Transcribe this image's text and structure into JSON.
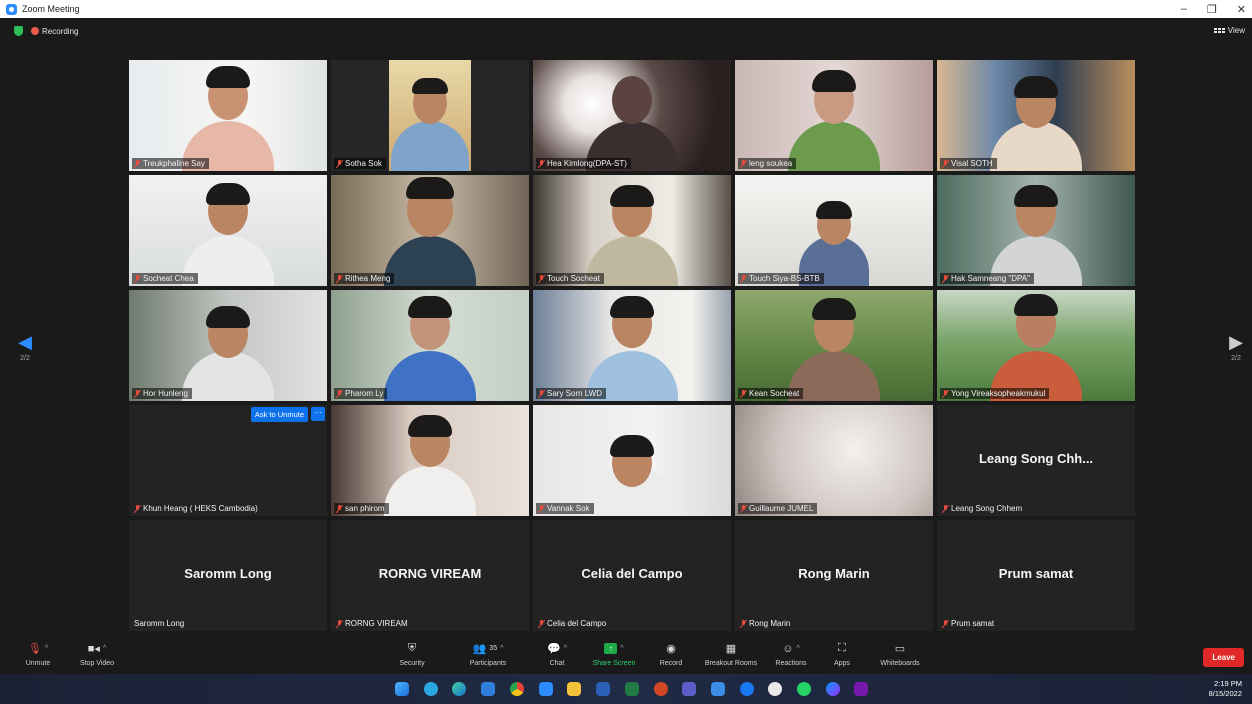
{
  "window": {
    "title": "Zoom Meeting",
    "min": "–",
    "restore": "❐",
    "close": "✕"
  },
  "header": {
    "recording_label": "Recording",
    "view_label": "View"
  },
  "pagination": {
    "left_page": "2/2",
    "right_page": "2/2"
  },
  "participants": [
    {
      "name": "Treukphaline Say",
      "muted": true
    },
    {
      "name": "Sotha Sok",
      "muted": true
    },
    {
      "name": "Hea Kimlong(DPA-ST)",
      "muted": true
    },
    {
      "name": "leng soukea",
      "muted": true
    },
    {
      "name": "Visal SOTH",
      "muted": true
    },
    {
      "name": "Socheat Chea",
      "muted": true
    },
    {
      "name": "Rithea Meng",
      "muted": true
    },
    {
      "name": "Touch Socheat",
      "muted": true
    },
    {
      "name": "Touch Siya-BS-BTB",
      "muted": true
    },
    {
      "name": "Hak Samneang \"DPA\"",
      "muted": true
    },
    {
      "name": "Hor Hunleng",
      "muted": true
    },
    {
      "name": "Pharom Ly",
      "muted": true
    },
    {
      "name": "Sary Sorn LWD",
      "muted": true
    },
    {
      "name": "Kean Socheat",
      "muted": true
    },
    {
      "name": "Yong Vireaksopheakmukul",
      "muted": true
    },
    {
      "name": "Khun Heang ( HEKS Cambodia)",
      "muted": true
    },
    {
      "name": "san phirom",
      "muted": true
    },
    {
      "name": "Vannak Sok",
      "muted": true
    },
    {
      "name": "Guillaume JUMEL",
      "muted": true
    },
    {
      "name": "Leang Song Chhem",
      "display": "Leang Song Chh...",
      "muted": true
    },
    {
      "name": "Saromm Long",
      "display": "Saromm Long",
      "muted": false
    },
    {
      "name": "RORNG VIREAM",
      "display": "RORNG VIREAM",
      "muted": true
    },
    {
      "name": "Celia del Campo",
      "display": "Celia del Campo",
      "muted": true
    },
    {
      "name": "Rong Marin",
      "display": "Rong Marin",
      "muted": true
    },
    {
      "name": "Prum samat",
      "display": "Prum samat",
      "muted": true
    }
  ],
  "ask_unmute": {
    "label": "Ask to Unmute",
    "more": "···"
  },
  "toolbar": {
    "unmute": "Unmute",
    "stop_video": "Stop Video",
    "security": "Security",
    "participants": "Participants",
    "participants_count": "35",
    "chat": "Chat",
    "share_screen": "Share Screen",
    "record": "Record",
    "breakout_rooms": "Breakout Rooms",
    "reactions": "Reactions",
    "apps": "Apps",
    "whiteboards": "Whiteboards",
    "leave": "Leave"
  },
  "taskbar": {
    "time": "2:19 PM",
    "date": "8/15/2022",
    "icons": [
      "windows-start-icon",
      "telegram-icon",
      "edge-icon",
      "onedrive-icon",
      "chrome-icon",
      "zoom-icon",
      "file-explorer-icon",
      "word-icon",
      "excel-icon",
      "powerpoint-icon",
      "teams-icon",
      "todo-icon",
      "facebook-icon",
      "media-player-icon",
      "whatsapp-icon",
      "messenger-icon",
      "onenote-icon"
    ]
  },
  "colors": {
    "accent": "#2d8cff",
    "leave": "#e02828",
    "share": "#1faa4a",
    "muted_mic": "#e74c3c"
  }
}
